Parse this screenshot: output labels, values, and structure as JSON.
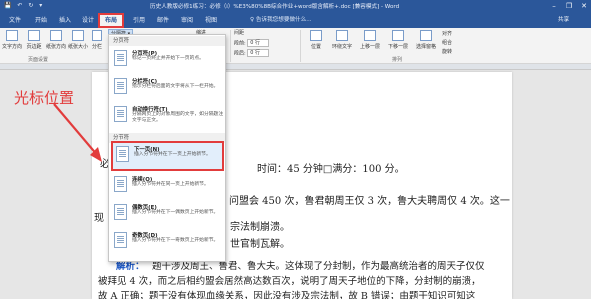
{
  "titlebar": {
    "quick_access": "💾 ↶ ↻ ▾",
    "title": "历史人教版必修1练习：必修（ⅰ）%E3%80%8B综合作业+word版含解析+.doc [兼容模式] - Word",
    "min": "–",
    "max": "❐",
    "close": "✕"
  },
  "tabs": [
    "文件",
    "开始",
    "插入",
    "设计",
    "布局",
    "引用",
    "邮件",
    "审阅",
    "视图"
  ],
  "search_prompt": "♀ 告诉我您想要做什么...",
  "share": "共享",
  "ribbon": {
    "buttons": [
      "文字方向",
      "页边距",
      "纸张方向",
      "纸张大小",
      "分栏"
    ],
    "breaks_button": "分隔符 ▾",
    "group_label_page_setup": "页面设置",
    "indent_label": "缩进",
    "spacing_label": "间距",
    "before_label": "段前:",
    "after_label": "段后:",
    "before_value": "0 行",
    "after_value": "0 行",
    "arrange_label": "排列",
    "arrange_items": [
      "位置",
      "环绕文字",
      "上移一层",
      "下移一层",
      "选择窗格",
      "对齐",
      "组合",
      "旋转"
    ]
  },
  "dropdown": {
    "section_page_breaks": "分页符",
    "section_section_breaks": "分节符",
    "items_page": [
      {
        "title": "分页符(P)",
        "desc": "标记一页终止并开始下一页的点。"
      },
      {
        "title": "分栏符(C)",
        "desc": "指示分栏符后面的文字将从下一栏开始。"
      },
      {
        "title": "自动换行符(T)",
        "desc": "分隔网页上的对象周围的文字，如分隔题注文字与正文。"
      }
    ],
    "items_section": [
      {
        "title": "下一页(N)",
        "desc": "插入分节符并在下一页上开始新节。"
      },
      {
        "title": "连续(O)",
        "desc": "插入分节符并在同一页上开始新节。"
      },
      {
        "title": "偶数页(E)",
        "desc": "插入分节符并在下一偶数页上开始新节。"
      },
      {
        "title": "奇数页(D)",
        "desc": "插入分节符并在下一奇数页上开始新节。"
      }
    ]
  },
  "annotation": {
    "label": "光标位置",
    "color": "#e23c3c"
  },
  "document": {
    "line_cursor": "必",
    "line_time": "时间：45 分钟□满分：100 分。",
    "line_1": "问盟会 450 次，鲁君朝周王仅 3 次，鲁大夫聘周仅 4 次。这一",
    "line_2_left": "现",
    "line_2_right": "宗法制崩溃。",
    "line_3_right": "世官制瓦解。",
    "analysis_label": "解析：",
    "analysis_1": "题干涉及周王、鲁君、鲁大夫。这体现了分封制，作为最高统治者的周天子仅仅",
    "analysis_2": "被拜见 4 次，而之后相约盟会居然高达数百次，说明了周天子地位的下降，分封制的崩溃，",
    "analysis_3": "故 A 正确；题干没有体现血缘关系，因此没有涉及宗法制，故 B 错误；由题干知识可知这"
  }
}
